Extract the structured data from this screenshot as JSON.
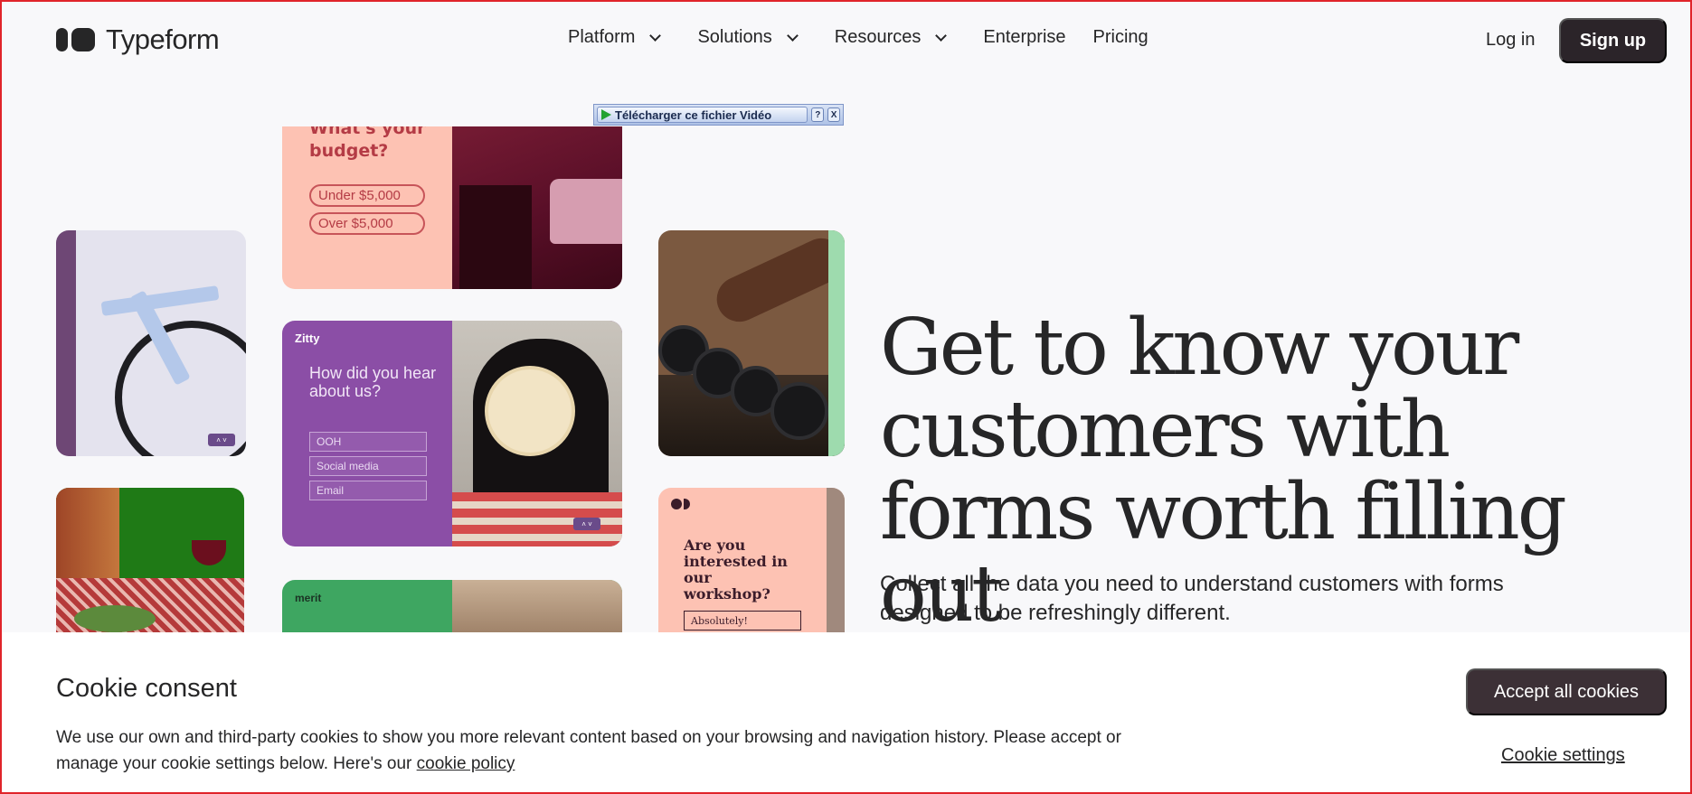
{
  "brand": {
    "name": "Typeform"
  },
  "nav": {
    "items": [
      {
        "label": "Platform",
        "dropdown": true
      },
      {
        "label": "Solutions",
        "dropdown": true
      },
      {
        "label": "Resources",
        "dropdown": true
      },
      {
        "label": "Enterprise",
        "dropdown": false
      },
      {
        "label": "Pricing",
        "dropdown": false
      }
    ],
    "login": "Log in",
    "signup": "Sign up"
  },
  "download_bar": {
    "label": "Télécharger ce fichier Vidéo",
    "help": "?",
    "close": "X"
  },
  "collage": {
    "budget_card": {
      "question": "What's your budget?",
      "options": [
        "Under $5,000",
        "Over $5,000"
      ]
    },
    "zitty_card": {
      "brand": "Zitty",
      "question": "How did you hear about us?",
      "options": [
        "OOH",
        "Social media",
        "Email"
      ]
    },
    "merit_card": {
      "brand": "merit"
    },
    "workshop_card": {
      "question": "Are you interested in our workshop?",
      "answer": "Absolutely!"
    }
  },
  "hero": {
    "title": "Get to know your customers with forms worth filling out",
    "subtitle": "Collect all the data you need to understand customers with forms designed to be refreshingly different."
  },
  "cookie": {
    "title": "Cookie consent",
    "text": "We use our own and third-party cookies to show you more relevant content based on your browsing and navigation history. Please accept or manage your cookie settings below. Here's our",
    "policy_link": "cookie policy",
    "accept": "Accept all cookies",
    "settings": "Cookie settings"
  },
  "colors": {
    "brand_dark": "#262627",
    "button_dark": "#2b2429",
    "accent_frame": "#e0242a"
  }
}
